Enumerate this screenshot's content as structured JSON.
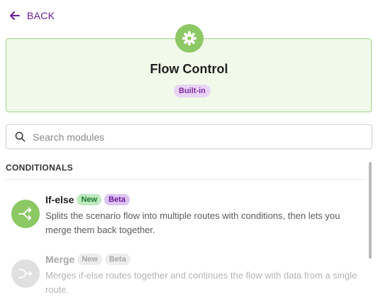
{
  "nav": {
    "back_label": "BACK"
  },
  "app": {
    "title": "Flow Control",
    "badge": "Built-in",
    "accent": "#8cc864"
  },
  "search": {
    "placeholder": "Search modules",
    "value": ""
  },
  "section": {
    "title": "CONDITIONALS"
  },
  "modules": [
    {
      "name": "If-else",
      "badges": [
        "New",
        "Beta"
      ],
      "description": "Splits the scenario flow into multiple routes with conditions, then lets you merge them back together.",
      "icon": "split-icon",
      "enabled": true
    },
    {
      "name": "Merge",
      "badges": [
        "New",
        "Beta"
      ],
      "description": "Merges if-else routes together and continues the flow with data from a single route.",
      "icon": "merge-icon",
      "enabled": false
    }
  ]
}
